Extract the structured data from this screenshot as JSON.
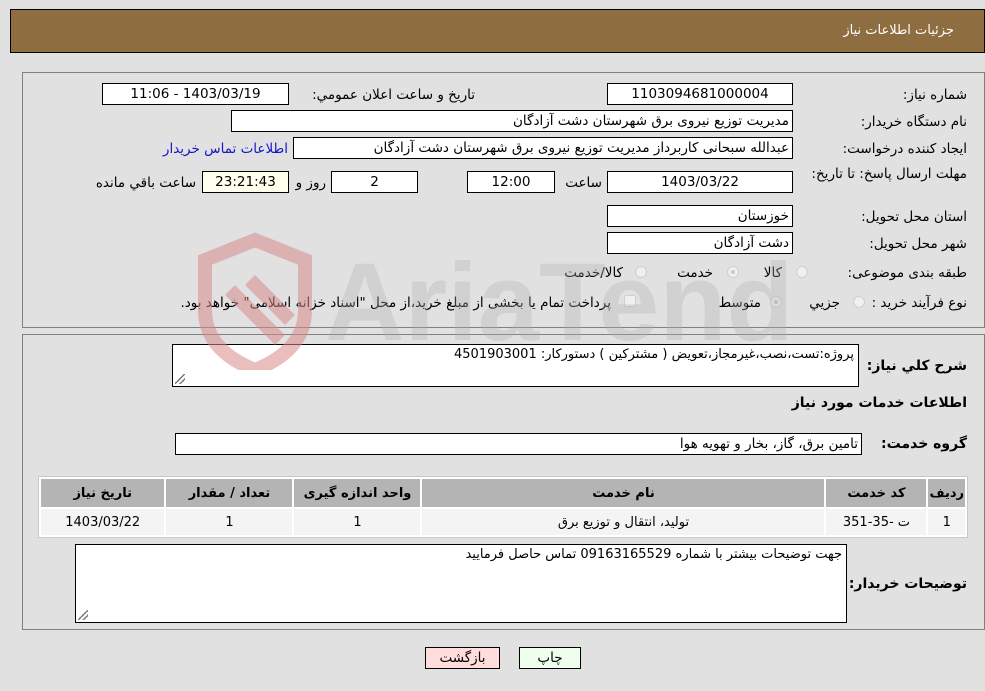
{
  "header": {
    "title": "جزئیات اطلاعات نیاز"
  },
  "details": {
    "need_number_label": "شماره نیاز:",
    "need_number": "1103094681000004",
    "announce_label": "تاريخ و ساعت اعلان عمومي:",
    "announce_value": "1403/03/19 - 11:06",
    "buyer_org_label": "نام دستگاه خريدار:",
    "buyer_org": "مديريت توزيع نيروی برق شهرستان دشت آزادگان",
    "creator_label": "ايجاد کننده درخواست:",
    "creator": "عبدالله سبحانی کاربرداز مديريت توزيع نيروی برق شهرستان دشت آزادگان",
    "contact_link": "اطلاعات تماس خريدار",
    "deadline_label": "مهلت ارسال پاسخ: تا تاريخ:",
    "deadline_date": "1403/03/22",
    "time_label": "ساعت",
    "deadline_time": "12:00",
    "days_value": "2",
    "days_label": "روز و",
    "remaining_time": "23:21:43",
    "remaining_label": "ساعت باقي مانده",
    "province_label": "استان محل تحويل:",
    "province": "خوزستان",
    "city_label": "شهر محل تحويل:",
    "city": "دشت آزادگان",
    "category_label": "طبقه بندی موضوعی:",
    "category_options": [
      "کالا",
      "خدمت",
      "کالا/خدمت"
    ],
    "category_selected": "خدمت",
    "process_label": "نوع فرآيند خريد :",
    "process_options": [
      "جزيي",
      "متوسط"
    ],
    "process_selected": "متوسط",
    "treasury_note": "پرداخت تمام يا بخشی از مبلغ خريد،از محل \"اسناد خزانه اسلامی\" خواهد بود."
  },
  "summary": {
    "description_label": "شرح كلي نياز:",
    "description": "پروژه:تست،نصب،غيرمجاز،تعويض ( مشتركين )  دستوركار: 4501903001",
    "services_heading": "اطلاعات خدمات مورد نياز",
    "service_group_label": "گروه خدمت:",
    "service_group": "تامين برق، گاز، بخار و تهويه هوا"
  },
  "table": {
    "headers": [
      "رديف",
      "كد خدمت",
      "نام خدمت",
      "واحد اندازه گيری",
      "تعداد / مقدار",
      "تاريخ نياز"
    ],
    "rows": [
      [
        "1",
        "ت -35-351",
        "توليد، انتقال و توزيع برق",
        "1",
        "1",
        "1403/03/22"
      ]
    ]
  },
  "buyer_notes": {
    "label": "توضيحات خريدار:",
    "text": "جهت توضيحات بيشتر با شماره 09163165529 تماس حاصل فرماييد"
  },
  "buttons": {
    "print": "چاپ",
    "back": "بازگشت"
  },
  "colors": {
    "header_bg": "#8e6d41",
    "print_bg": "#eeffee",
    "back_bg": "#ffdddd",
    "link": "#1515c8"
  },
  "watermark": {
    "text": "AriaTender.neT"
  }
}
